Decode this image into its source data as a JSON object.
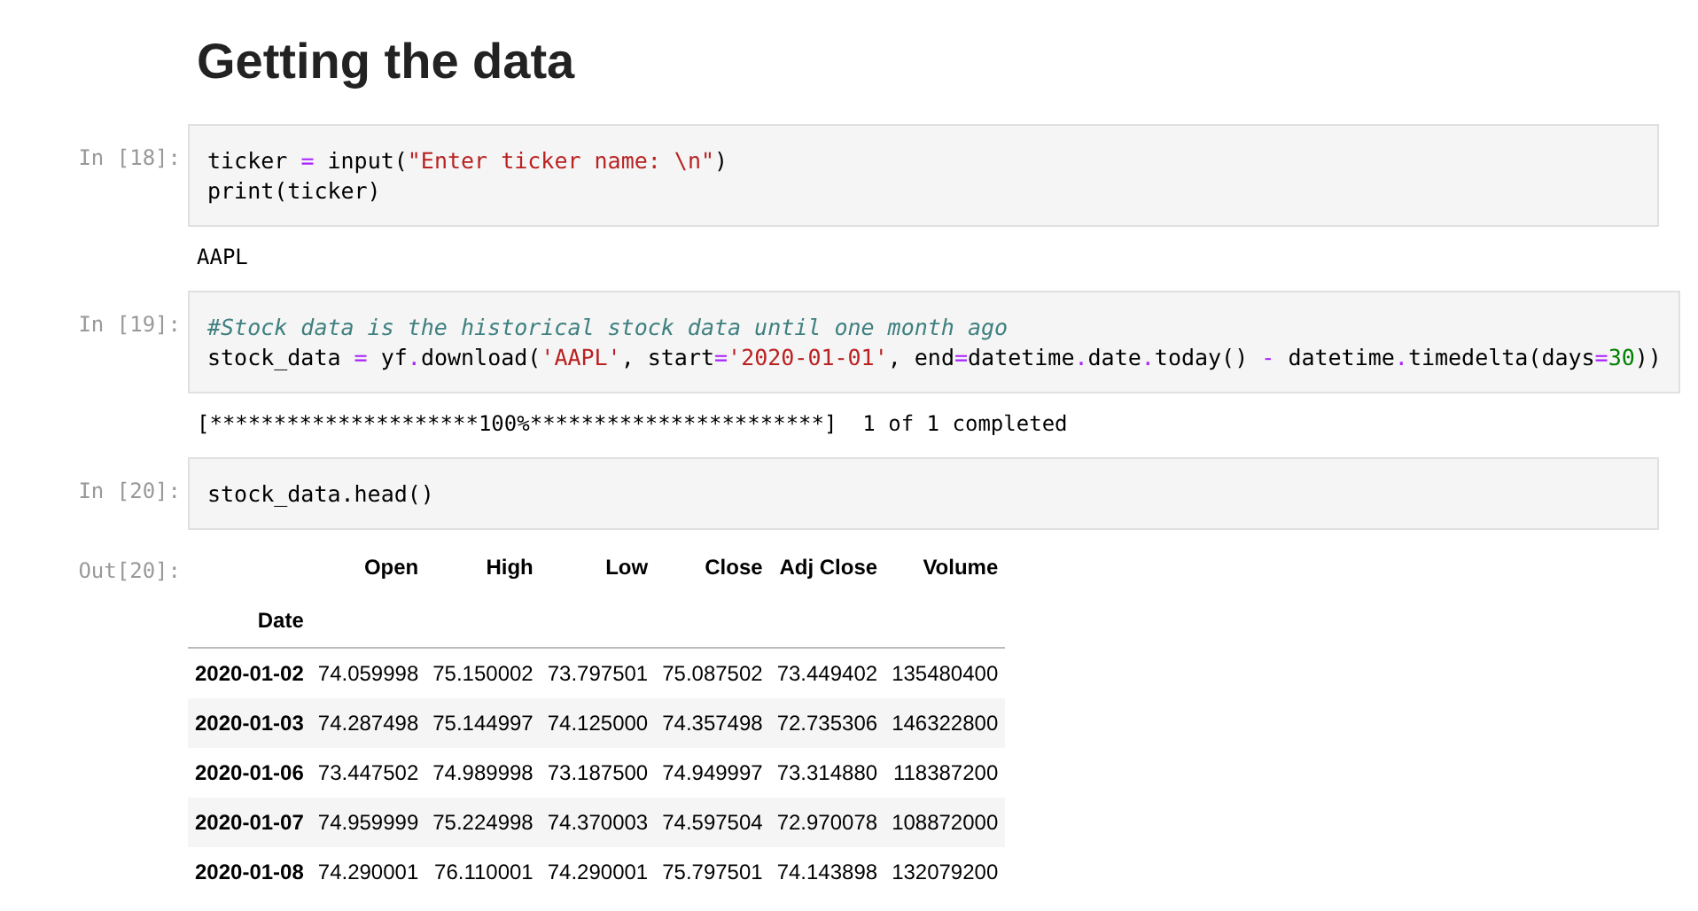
{
  "heading": "Getting the data",
  "cells": [
    {
      "prompt": "In [18]:",
      "code": [
        [
          {
            "text": "ticker ",
            "kind": "plain"
          },
          {
            "text": "=",
            "kind": "op"
          },
          {
            "text": " input(",
            "kind": "plain"
          },
          {
            "text": "\"Enter ticker name: \\n\"",
            "kind": "str"
          },
          {
            "text": ")",
            "kind": "plain"
          }
        ],
        [
          {
            "text": "print(ticker)",
            "kind": "plain"
          }
        ]
      ],
      "output": "AAPL"
    },
    {
      "prompt": "In [19]:",
      "code": [
        [
          {
            "text": "#Stock data is the historical stock data until one month ago",
            "kind": "comment"
          }
        ],
        [
          {
            "text": "stock_data ",
            "kind": "plain"
          },
          {
            "text": "=",
            "kind": "op"
          },
          {
            "text": " yf",
            "kind": "plain"
          },
          {
            "text": ".",
            "kind": "op"
          },
          {
            "text": "download(",
            "kind": "plain"
          },
          {
            "text": "'AAPL'",
            "kind": "str"
          },
          {
            "text": ", start",
            "kind": "plain"
          },
          {
            "text": "=",
            "kind": "op"
          },
          {
            "text": "'2020-01-01'",
            "kind": "str"
          },
          {
            "text": ", end",
            "kind": "plain"
          },
          {
            "text": "=",
            "kind": "op"
          },
          {
            "text": "datetime",
            "kind": "plain"
          },
          {
            "text": ".",
            "kind": "op"
          },
          {
            "text": "date",
            "kind": "plain"
          },
          {
            "text": ".",
            "kind": "op"
          },
          {
            "text": "today() ",
            "kind": "plain"
          },
          {
            "text": "-",
            "kind": "op"
          },
          {
            "text": " datetime",
            "kind": "plain"
          },
          {
            "text": ".",
            "kind": "op"
          },
          {
            "text": "timedelta(days",
            "kind": "plain"
          },
          {
            "text": "=",
            "kind": "op"
          },
          {
            "text": "30",
            "kind": "num"
          },
          {
            "text": "))",
            "kind": "plain"
          }
        ]
      ],
      "output": "[*********************100%***********************]  1 of 1 completed"
    },
    {
      "prompt": "In [20]:",
      "code": [
        [
          {
            "text": "stock_data.head()",
            "kind": "plain"
          }
        ]
      ]
    }
  ],
  "out_prompt": "Out[20]:",
  "table": {
    "columns": [
      "",
      "Open",
      "High",
      "Low",
      "Close",
      "Adj Close",
      "Volume"
    ],
    "index_name": "Date",
    "rows": [
      [
        "2020-01-02",
        "74.059998",
        "75.150002",
        "73.797501",
        "75.087502",
        "73.449402",
        "135480400"
      ],
      [
        "2020-01-03",
        "74.287498",
        "75.144997",
        "74.125000",
        "74.357498",
        "72.735306",
        "146322800"
      ],
      [
        "2020-01-06",
        "73.447502",
        "74.989998",
        "73.187500",
        "74.949997",
        "73.314880",
        "118387200"
      ],
      [
        "2020-01-07",
        "74.959999",
        "75.224998",
        "74.370003",
        "74.597504",
        "72.970078",
        "108872000"
      ],
      [
        "2020-01-08",
        "74.290001",
        "76.110001",
        "74.290001",
        "75.797501",
        "74.143898",
        "132079200"
      ]
    ]
  }
}
